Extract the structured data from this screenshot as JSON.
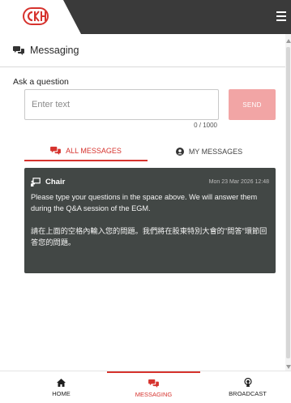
{
  "header": {
    "logo_icon": "ckh-logo",
    "menu_icon": "hamburger-menu-icon",
    "brand_color": "#d6332e",
    "bar_color": "#3a3a3a"
  },
  "page": {
    "title": "Messaging",
    "title_icon": "chat-bubbles-icon"
  },
  "ask": {
    "label": "Ask a question",
    "input_placeholder": "Enter text",
    "input_value": "",
    "send_label": "SEND",
    "char_count": "0 / 1000",
    "send_color": "#f2a5a5"
  },
  "tabs": [
    {
      "label": "ALL MESSAGES",
      "icon": "chat-bubbles-icon",
      "active": true
    },
    {
      "label": "MY MESSAGES",
      "icon": "user-circle-icon",
      "active": false
    }
  ],
  "messages": [
    {
      "sender": "Chair",
      "icon": "presenter-icon",
      "timestamp": "Mon 23 Mar 2026 12:48",
      "body_en": "Please type your questions in the space above.  We will answer them during the Q&A session of the EGM.",
      "body_zh": "請在上面的空格內輸入您的問題。我們將在股東特別大會的\"問答\"環節回答您的問題。"
    }
  ],
  "bottom_nav": [
    {
      "label": "HOME",
      "icon": "home-icon",
      "active": false
    },
    {
      "label": "MESSAGING",
      "icon": "chat-bubbles-icon",
      "active": true
    },
    {
      "label": "BROADCAST",
      "icon": "broadcast-icon",
      "active": false
    }
  ]
}
